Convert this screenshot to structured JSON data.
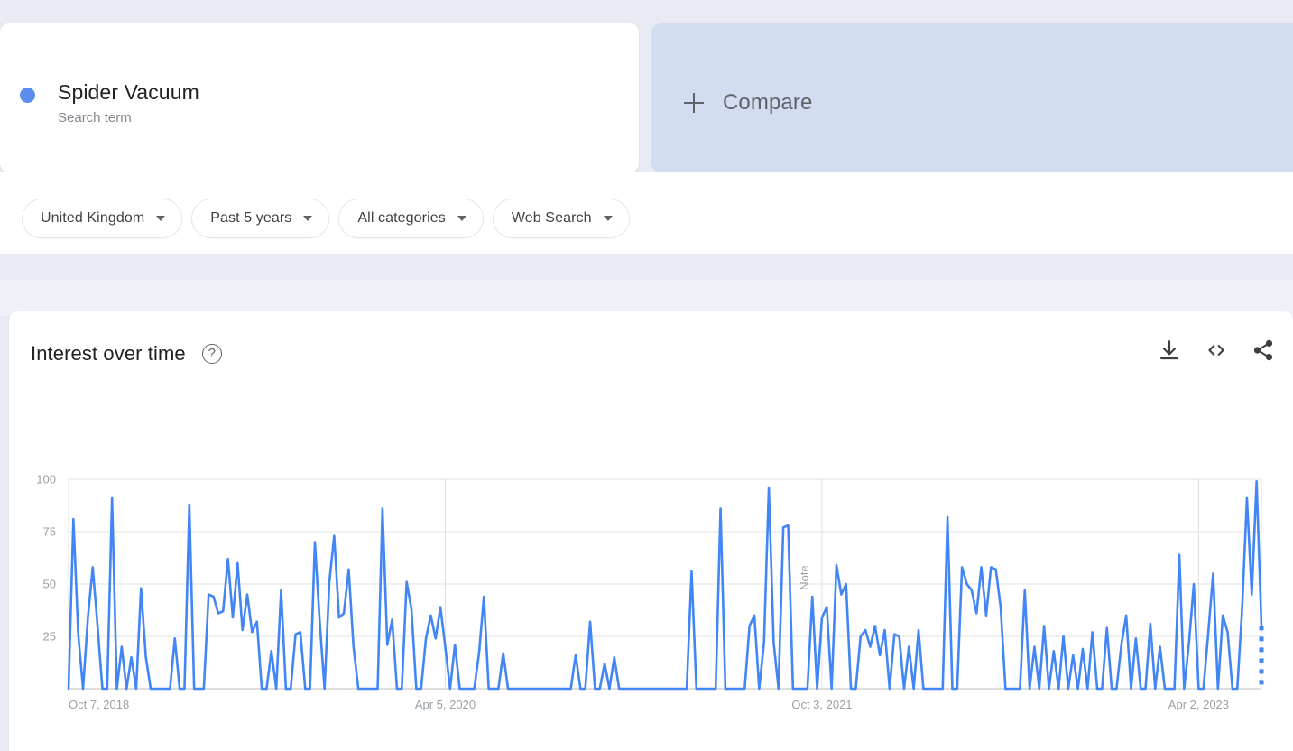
{
  "theme": {
    "page_bg": "#e8ebf4",
    "band_bg": "#eef1f8",
    "card_bg": "#ffffff",
    "compare_bg": "#d2ddf2",
    "series_color": "#4285f4",
    "series_dot_color": "#5b8def",
    "text_primary": "#202124",
    "text_secondary": "#5f6368",
    "text_muted": "#9aa0a6",
    "gridline": "#e0e0e0"
  },
  "search_term_card": {
    "term": "Spider Vacuum",
    "type_label": "Search term",
    "dot_color": "#5b8def"
  },
  "compare_card": {
    "label": "Compare",
    "plus_icon": "plus-icon"
  },
  "filters": [
    {
      "label": "United Kingdom",
      "icon": "chevron-down-icon"
    },
    {
      "label": "Past 5 years",
      "icon": "chevron-down-icon"
    },
    {
      "label": "All categories",
      "icon": "chevron-down-icon"
    },
    {
      "label": "Web Search",
      "icon": "chevron-down-icon"
    }
  ],
  "interest_panel": {
    "title": "Interest over time",
    "help_icon": "help-circle-icon",
    "help_glyph": "?",
    "actions": [
      {
        "name": "download-csv-button",
        "icon": "download-icon"
      },
      {
        "name": "embed-code-button",
        "icon": "code-brackets-icon"
      },
      {
        "name": "share-button",
        "icon": "share-icon"
      }
    ],
    "note_annotation": "Note"
  },
  "chart_data": {
    "type": "line",
    "title": "Interest over time",
    "xlabel": "",
    "ylabel": "",
    "ylim": [
      0,
      100
    ],
    "yticks": [
      25,
      50,
      75,
      100
    ],
    "ytick_labels": [
      "25",
      "50",
      "75",
      "100"
    ],
    "grid": true,
    "legend_position": "none",
    "xtick_labels": [
      "Oct 7, 2018",
      "Apr 5, 2020",
      "Oct 3, 2021",
      "Apr 2, 2023"
    ],
    "xtick_index": [
      0,
      78,
      156,
      234
    ],
    "x_start": "Oct 7, 2018",
    "x_end": "Oct 1, 2023",
    "interval": "weekly",
    "partial_last_point": true,
    "annotations": [
      {
        "label": "Note",
        "x_index": 151,
        "rotated": true
      }
    ],
    "series": [
      {
        "name": "Spider Vacuum",
        "color": "#4285f4",
        "values": [
          0,
          81,
          26,
          0,
          34,
          58,
          30,
          0,
          0,
          91,
          0,
          20,
          0,
          15,
          0,
          48,
          15,
          0,
          0,
          0,
          0,
          0,
          24,
          0,
          0,
          88,
          0,
          0,
          0,
          45,
          44,
          36,
          37,
          62,
          34,
          60,
          28,
          45,
          27,
          32,
          0,
          0,
          18,
          0,
          47,
          0,
          0,
          26,
          27,
          0,
          0,
          70,
          32,
          0,
          51,
          73,
          34,
          36,
          57,
          20,
          0,
          0,
          0,
          0,
          0,
          86,
          21,
          33,
          0,
          0,
          51,
          38,
          0,
          0,
          24,
          35,
          24,
          39,
          20,
          0,
          21,
          0,
          0,
          0,
          0,
          17,
          44,
          0,
          0,
          0,
          17,
          0,
          0,
          0,
          0,
          0,
          0,
          0,
          0,
          0,
          0,
          0,
          0,
          0,
          0,
          16,
          0,
          0,
          32,
          0,
          0,
          12,
          0,
          15,
          0,
          0,
          0,
          0,
          0,
          0,
          0,
          0,
          0,
          0,
          0,
          0,
          0,
          0,
          0,
          56,
          0,
          0,
          0,
          0,
          0,
          86,
          0,
          0,
          0,
          0,
          0,
          30,
          35,
          0,
          22,
          96,
          22,
          0,
          77,
          78,
          0,
          0,
          0,
          0,
          44,
          0,
          34,
          39,
          0,
          59,
          45,
          50,
          0,
          0,
          25,
          28,
          20,
          30,
          16,
          28,
          0,
          26,
          25,
          0,
          20,
          0,
          28,
          0,
          0,
          0,
          0,
          0,
          82,
          0,
          0,
          58,
          50,
          47,
          36,
          58,
          35,
          58,
          57,
          39,
          0,
          0,
          0,
          0,
          47,
          0,
          20,
          0,
          30,
          0,
          18,
          0,
          25,
          0,
          16,
          0,
          19,
          0,
          27,
          0,
          0,
          29,
          0,
          0,
          21,
          35,
          0,
          24,
          0,
          0,
          31,
          0,
          20,
          0,
          0,
          0,
          64,
          0,
          22,
          50,
          0,
          0,
          27,
          55,
          0,
          35,
          27,
          0,
          0,
          38,
          91,
          45,
          99,
          30
        ]
      }
    ]
  }
}
